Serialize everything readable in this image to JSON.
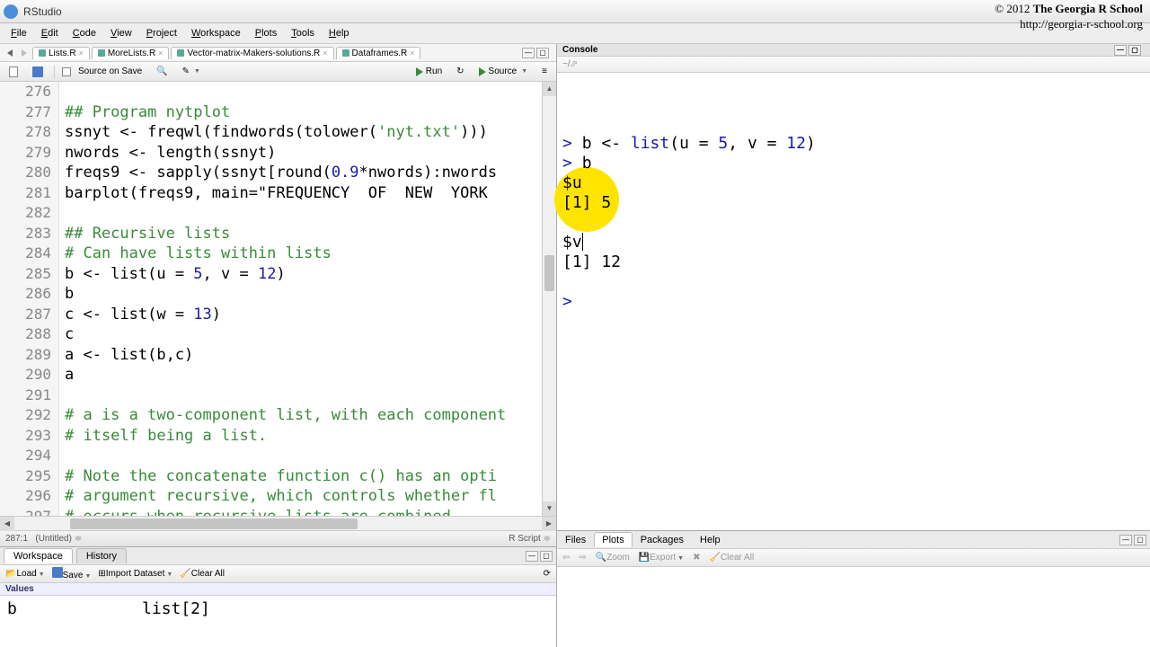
{
  "titlebar": {
    "app": "RStudio"
  },
  "copyright": {
    "line1": "© 2012 ",
    "brand": "The Georgia R School",
    "line2": "http://georgia-r-school.org"
  },
  "menu": [
    "File",
    "Edit",
    "Code",
    "View",
    "Project",
    "Workspace",
    "Plots",
    "Tools",
    "Help"
  ],
  "source": {
    "tabs": [
      {
        "label": "Lists.R"
      },
      {
        "label": "MoreLists.R"
      },
      {
        "label": "Vector-matrix-Makers-solutions.R"
      },
      {
        "label": "Dataframes.R"
      }
    ],
    "toolbar": {
      "source_on_save": "Source on Save",
      "run": "Run",
      "source": "Source"
    },
    "gutter_start": 276,
    "lines": [
      {
        "t": ""
      },
      {
        "t": "## Program nytplot",
        "c": "comment"
      },
      {
        "t": "ssnyt <- freqwl(findwords(tolower('nyt.txt')))"
      },
      {
        "t": "nwords <- length(ssnyt)"
      },
      {
        "t": "freqs9 <- sapply(ssnyt[round(0.9*nwords):nwords"
      },
      {
        "t": "barplot(freqs9, main=\"FREQUENCY  OF  NEW  YORK"
      },
      {
        "t": ""
      },
      {
        "t": "## Recursive lists",
        "c": "comment"
      },
      {
        "t": "# Can have lists within lists",
        "c": "comment"
      },
      {
        "t": "b <- list(u = 5, v = 12)"
      },
      {
        "t": "b"
      },
      {
        "t": "c <- list(w = 13)"
      },
      {
        "t": "c"
      },
      {
        "t": "a <- list(b,c)"
      },
      {
        "t": "a"
      },
      {
        "t": ""
      },
      {
        "t": "# a is a two-component list, with each component",
        "c": "comment"
      },
      {
        "t": "# itself being a list.",
        "c": "comment"
      },
      {
        "t": ""
      },
      {
        "t": "# Note the concatenate function c() has an opti",
        "c": "comment"
      },
      {
        "t": "# argument recursive, which controls whether fl",
        "c": "comment"
      },
      {
        "t": "# occurs when recursive lists are combined.",
        "c": "comment"
      }
    ],
    "status": {
      "pos": "287:1",
      "name": "(Untitled)",
      "type": "R Script"
    }
  },
  "workspace": {
    "tabs": [
      "Workspace",
      "History"
    ],
    "toolbar": {
      "load": "Load",
      "save": "Save",
      "import": "Import Dataset",
      "clear": "Clear All"
    },
    "section": "Values",
    "var": "b",
    "val": "list[2]"
  },
  "console": {
    "title": "Console",
    "path": "~/  ",
    "lines": [
      "> b <- list(u = 5, v = 12)",
      "> b",
      "$u",
      "[1] 5",
      "",
      "$v",
      "[1] 12",
      "",
      "> "
    ]
  },
  "plots": {
    "tabs": [
      "Files",
      "Plots",
      "Packages",
      "Help"
    ],
    "toolbar": {
      "zoom": "Zoom",
      "export": "Export",
      "clear": "Clear All"
    }
  }
}
